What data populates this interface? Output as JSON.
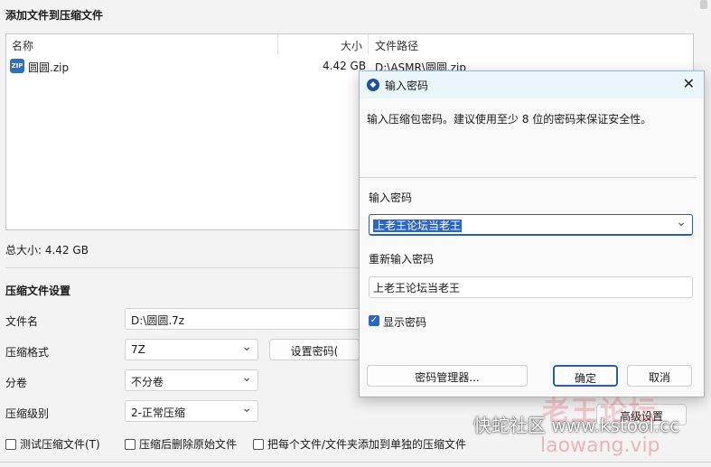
{
  "main": {
    "add_files_title": "添加文件到压缩文件",
    "list": {
      "col_name": "名称",
      "col_size": "大小",
      "col_path": "文件路径",
      "rows": [
        {
          "icon": "zip-file-icon",
          "icon_text": "ZIP",
          "name": "圆圆.zip",
          "size": "4.42 GB",
          "path": "D:\\ASMR\\圆圆.zip"
        }
      ]
    },
    "total_size": "总大小: 4.42 GB",
    "settings_title": "压缩文件设置",
    "filename_label": "文件名",
    "filename_value": "D:\\圆圆.7z",
    "format_label": "压缩格式",
    "format_value": "7Z",
    "set_password_button": "设置密码(",
    "split_label": "分卷",
    "split_value": "不分卷",
    "level_label": "压缩级别",
    "level_value": "2-正常压缩",
    "advanced_button": "高级设置",
    "checkboxes": {
      "test": "测试压缩文件(T)",
      "delete_after": "压缩后删除原始文件",
      "each_separate": "把每个文件/文件夹添加到单独的压缩文件"
    }
  },
  "dialog": {
    "title": "输入密码",
    "close_glyph": "✕",
    "message": "输入压缩包密码。建议使用至少 8 位的密码来保证安全性。",
    "password_label": "输入密码",
    "password_value": "上老王论坛当老王",
    "reenter_label": "重新输入密码",
    "reenter_value": "上老王论坛当老王",
    "show_password_label": "显示密码",
    "show_password_checked": true,
    "manager_button": "密码管理器...",
    "ok_button": "确定",
    "cancel_button": "取消",
    "accent_color": "#2a66c7"
  },
  "watermark": {
    "line1": "老王论坛",
    "line2": "快蛇社区 www.kstool.cc",
    "line3": "laowang.vip"
  }
}
